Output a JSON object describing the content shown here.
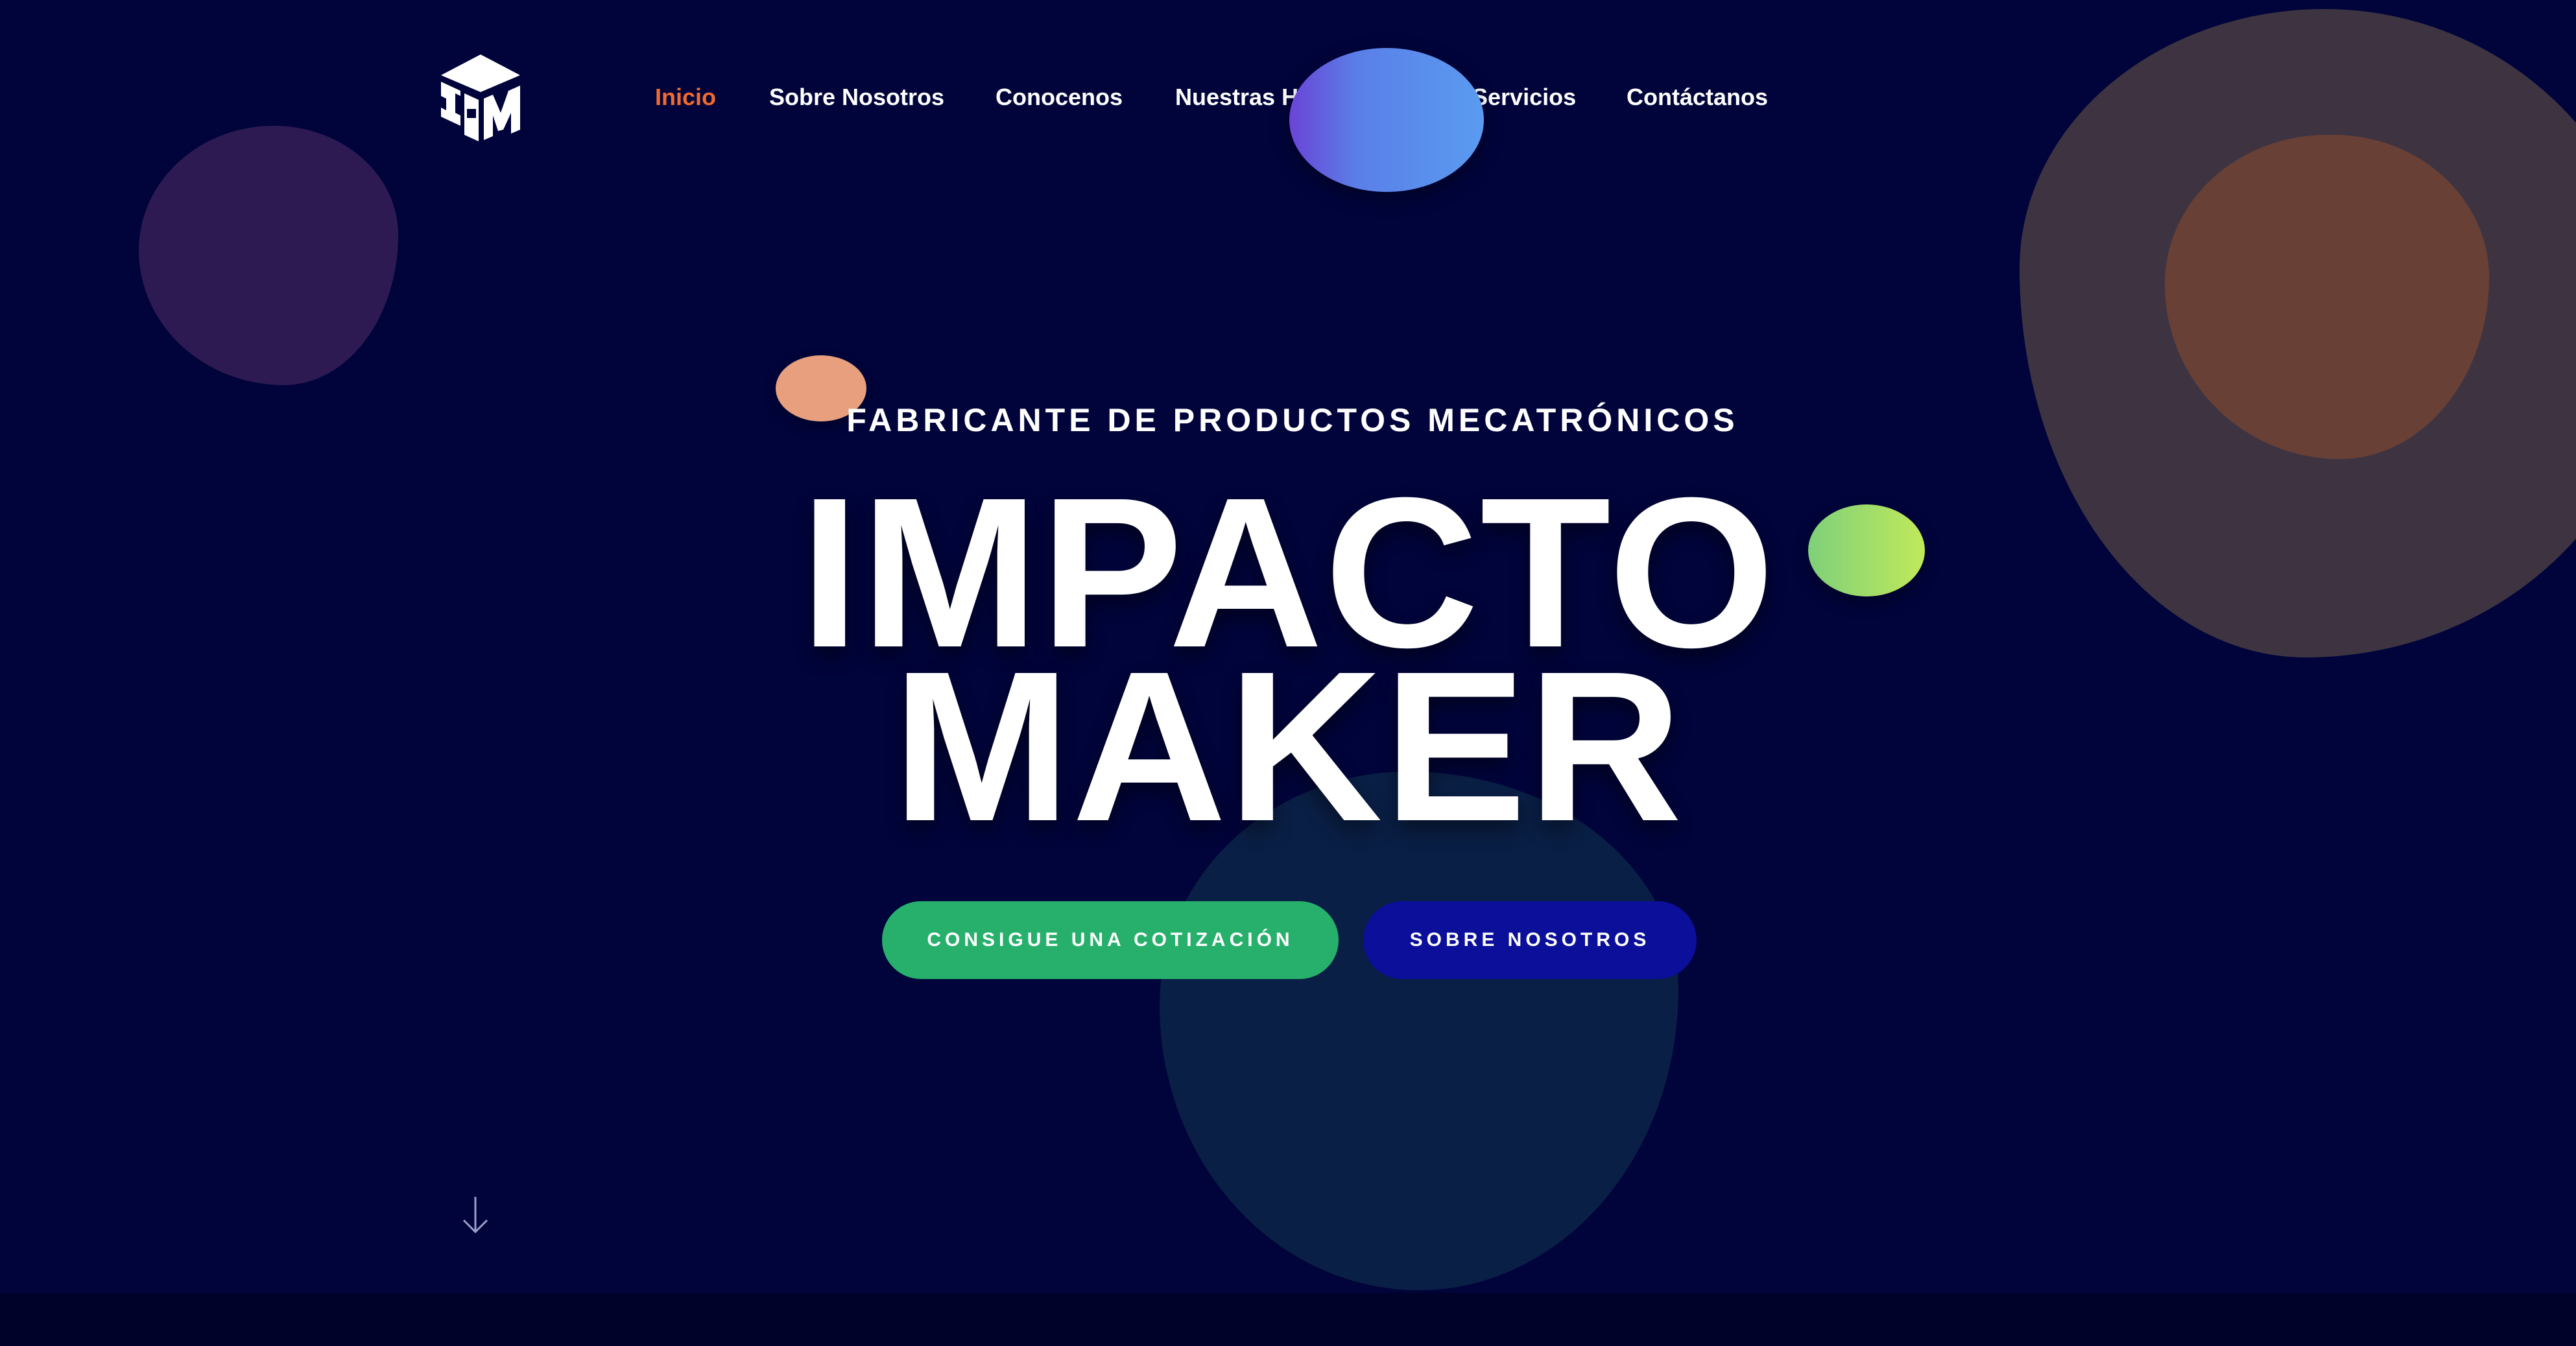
{
  "brand": {
    "logo_icon": "impacto-maker-cube-logo"
  },
  "nav": {
    "items": [
      {
        "label": "Inicio",
        "active": true
      },
      {
        "label": "Sobre Nosotros",
        "active": false
      },
      {
        "label": "Conocenos",
        "active": false
      },
      {
        "label": "Nuestras Habilidades",
        "active": false
      },
      {
        "label": "Servicios",
        "active": false
      },
      {
        "label": "Contáctanos",
        "active": false
      }
    ]
  },
  "hero": {
    "subtitle": "FABRICANTE DE PRODUCTOS MECATRÓNICOS",
    "title_line1": "IMPACTO",
    "title_line2": "MAKER",
    "primary_button": "CONSIGUE UNA COTIZACIÓN",
    "secondary_button": "SOBRE NOSOTROS",
    "scroll_icon": "arrow-down-icon"
  },
  "colors": {
    "background": "#00043a",
    "nav_active": "#f26a2e",
    "primary_button": "#27b06c",
    "secondary_button": "#0b0f99"
  }
}
